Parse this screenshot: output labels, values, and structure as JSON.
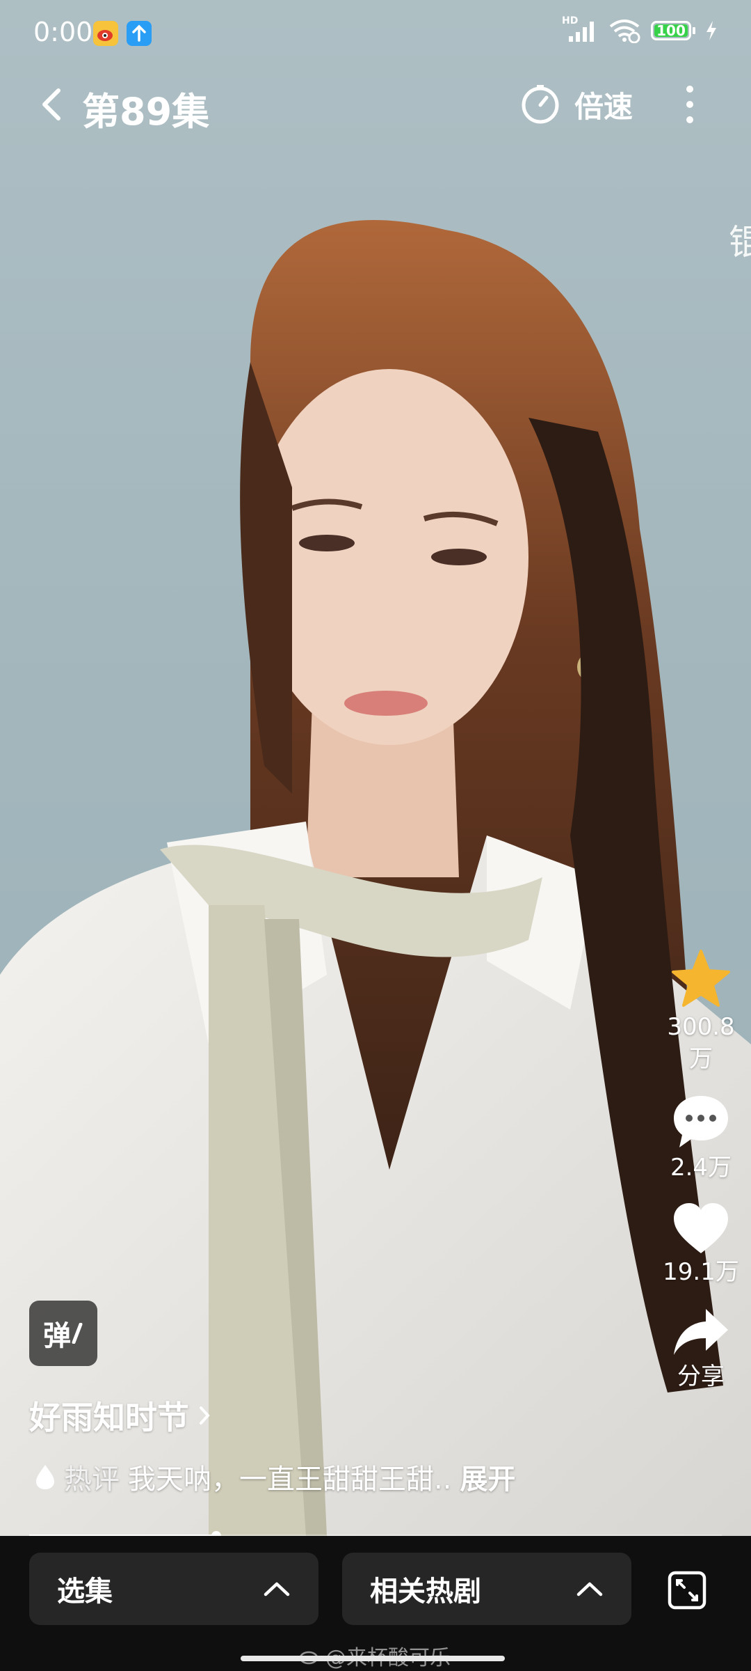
{
  "status_bar": {
    "time": "0:00",
    "network": "HD",
    "battery": "100"
  },
  "top_bar": {
    "episode_title": "第89集",
    "speed_label": "倍速"
  },
  "edge_text": "锟",
  "actions": {
    "favorite_count": "300.8万",
    "comment_count": "2.4万",
    "like_count": "19.1万",
    "share_label": "分享"
  },
  "overlay": {
    "danmu_label": "弹",
    "series_name": "好雨知时节",
    "hot_label": "热评",
    "hot_comment": "我天呐，一直王甜甜王甜..",
    "expand_label": "展开"
  },
  "playback": {
    "progress_fraction": 0.27
  },
  "bottom_bar": {
    "episodes_label": "选集",
    "related_label": "相关热剧"
  },
  "watermark": "@来杯酸可乐",
  "colors": {
    "favorite_star": "#f5b52e",
    "battery_green": "#37d24a",
    "bottom_bg": "#0f0f0f",
    "button_bg": "#262626"
  }
}
